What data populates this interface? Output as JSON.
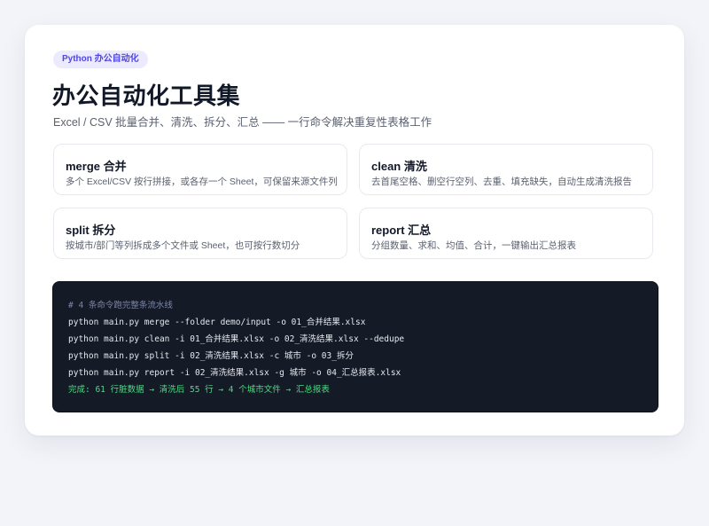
{
  "badge": "Python 办公自动化",
  "title": "办公自动化工具集",
  "subtitle": "Excel / CSV 批量合并、清洗、拆分、汇总 —— 一行命令解决重复性表格工作",
  "features": [
    {
      "name": "merge 合并",
      "desc": "多个 Excel/CSV 按行拼接，或各存一个 Sheet，可保留来源文件列"
    },
    {
      "name": "clean 清洗",
      "desc": "去首尾空格、删空行空列、去重、填充缺失，自动生成清洗报告"
    },
    {
      "name": "split 拆分",
      "desc": "按城市/部门等列拆成多个文件或 Sheet，也可按行数切分"
    },
    {
      "name": "report 汇总",
      "desc": "分组数量、求和、均值、合计，一键输出汇总报表"
    }
  ],
  "terminal": {
    "lines": [
      "# 4 条命令跑完整条流水线",
      "python main.py merge --folder demo/input -o 01_合并结果.xlsx",
      "python main.py clean -i 01_合并结果.xlsx -o 02_清洗结果.xlsx --dedupe",
      "python main.py split -i 02_清洗结果.xlsx -c 城市 -o 03_拆分",
      "python main.py report -i 02_清洗结果.xlsx -g 城市 -o 04_汇总报表.xlsx",
      "完成: 61 行脏数据 → 清洗后 55 行 → 4 个城市文件 → 汇总报表"
    ]
  },
  "colors": {
    "accent": "#4f46e5",
    "badge_bg": "#eceafe",
    "terminal_bg": "#141a26",
    "comment": "#7c86a6",
    "success": "#4ade80"
  }
}
